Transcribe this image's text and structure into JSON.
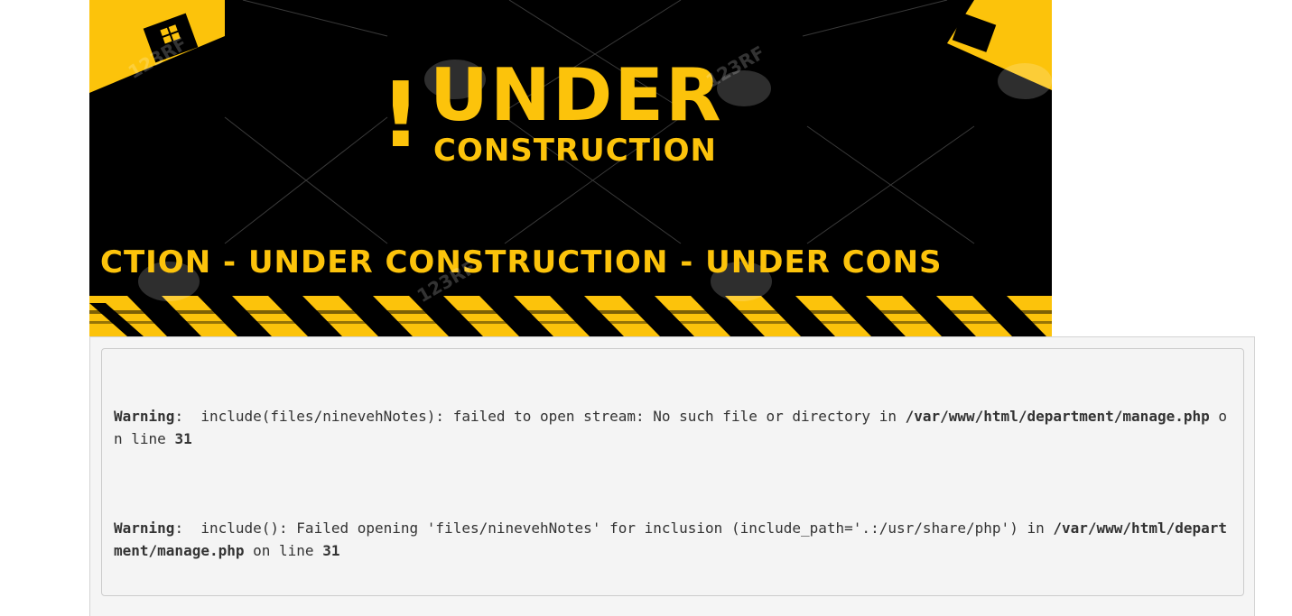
{
  "banner": {
    "exclamation": "!",
    "headline": "UNDER",
    "subhead": "CONSTRUCTION",
    "ticker": "CTION - UNDER  CONSTRUCTION - UNDER  CONS",
    "watermark": "123RF",
    "colors": {
      "accent": "#fcc30b",
      "background": "#000000"
    }
  },
  "errors": [
    {
      "label": "Warning",
      "message": ":  include(files/ninevehNotes): failed to open stream: No such file or directory in ",
      "file": "/var/www/html/department/manage.php",
      "on_line_text": " on line ",
      "line": "31"
    },
    {
      "label": "Warning",
      "message": ":  include(): Failed opening 'files/ninevehNotes' for inclusion (include_path='.:/usr/share/php') in ",
      "file": "/var/www/html/department/manage.php",
      "on_line_text": " on line ",
      "line": "31"
    }
  ]
}
